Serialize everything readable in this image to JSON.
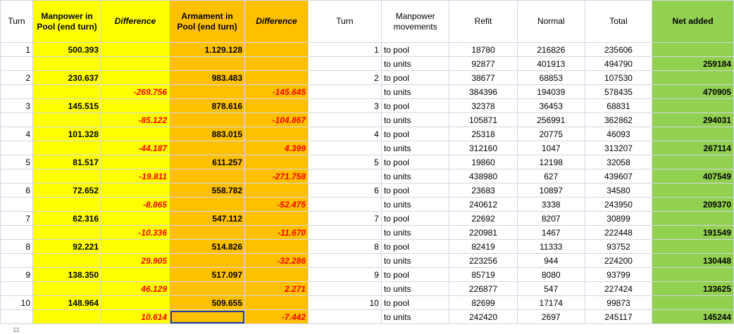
{
  "left_headers": {
    "turn": "Turn",
    "manpower": "Manpower in Pool (end turn)",
    "difference1": "Difference",
    "armament": "Armament in Pool (end turn)",
    "difference2": "Difference"
  },
  "right_headers": {
    "turn": "Turn",
    "movements": "Manpower movements",
    "refit": "Refit",
    "normal": "Normal",
    "total": "Total",
    "net": "Net added"
  },
  "left_rows": [
    {
      "turn": "1",
      "manpower": "500.393",
      "diff1": "",
      "armament": "1.129.128",
      "diff2": ""
    },
    {
      "turn": "",
      "manpower": "",
      "diff1": "",
      "armament": "",
      "diff2": ""
    },
    {
      "turn": "2",
      "manpower": "230.637",
      "diff1": "",
      "armament": "983.483",
      "diff2": ""
    },
    {
      "turn": "",
      "manpower": "",
      "diff1": "-269.756",
      "armament": "",
      "diff2": "-145.645"
    },
    {
      "turn": "3",
      "manpower": "145.515",
      "diff1": "",
      "armament": "878.616",
      "diff2": ""
    },
    {
      "turn": "",
      "manpower": "",
      "diff1": "-85.122",
      "armament": "",
      "diff2": "-104.867"
    },
    {
      "turn": "4",
      "manpower": "101.328",
      "diff1": "",
      "armament": "883.015",
      "diff2": ""
    },
    {
      "turn": "",
      "manpower": "",
      "diff1": "-44.187",
      "armament": "",
      "diff2": "4.399"
    },
    {
      "turn": "5",
      "manpower": "81.517",
      "diff1": "",
      "armament": "611.257",
      "diff2": ""
    },
    {
      "turn": "",
      "manpower": "",
      "diff1": "-19.811",
      "armament": "",
      "diff2": "-271.758"
    },
    {
      "turn": "6",
      "manpower": "72.652",
      "diff1": "",
      "armament": "558.782",
      "diff2": ""
    },
    {
      "turn": "",
      "manpower": "",
      "diff1": "-8.865",
      "armament": "",
      "diff2": "-52.475"
    },
    {
      "turn": "7",
      "manpower": "62.316",
      "diff1": "",
      "armament": "547.112",
      "diff2": ""
    },
    {
      "turn": "",
      "manpower": "",
      "diff1": "-10.336",
      "armament": "",
      "diff2": "-11.670"
    },
    {
      "turn": "8",
      "manpower": "92.221",
      "diff1": "",
      "armament": "514.826",
      "diff2": ""
    },
    {
      "turn": "",
      "manpower": "",
      "diff1": "29.905",
      "armament": "",
      "diff2": "-32.286"
    },
    {
      "turn": "9",
      "manpower": "138.350",
      "diff1": "",
      "armament": "517.097",
      "diff2": ""
    },
    {
      "turn": "",
      "manpower": "",
      "diff1": "46.129",
      "armament": "",
      "diff2": "2.271"
    },
    {
      "turn": "10",
      "manpower": "148.964",
      "diff1": "",
      "armament": "509.655",
      "diff2": ""
    },
    {
      "turn": "",
      "manpower": "",
      "diff1": "10.614",
      "armament": "",
      "diff2": "-7.442"
    }
  ],
  "right_rows": [
    {
      "turn": "1",
      "move": "to pool",
      "refit": "18780",
      "normal": "216826",
      "total": "235606",
      "net": ""
    },
    {
      "turn": "",
      "move": "to units",
      "refit": "92877",
      "normal": "401913",
      "total": "494790",
      "net": "259184"
    },
    {
      "turn": "2",
      "move": "to pool",
      "refit": "38677",
      "normal": "68853",
      "total": "107530",
      "net": ""
    },
    {
      "turn": "",
      "move": "to units",
      "refit": "384396",
      "normal": "194039",
      "total": "578435",
      "net": "470905"
    },
    {
      "turn": "3",
      "move": "to pool",
      "refit": "32378",
      "normal": "36453",
      "total": "68831",
      "net": ""
    },
    {
      "turn": "",
      "move": "to units",
      "refit": "105871",
      "normal": "256991",
      "total": "362862",
      "net": "294031"
    },
    {
      "turn": "4",
      "move": "to pool",
      "refit": "25318",
      "normal": "20775",
      "total": "46093",
      "net": ""
    },
    {
      "turn": "",
      "move": "to units",
      "refit": "312160",
      "normal": "1047",
      "total": "313207",
      "net": "267114"
    },
    {
      "turn": "5",
      "move": "to pool",
      "refit": "19860",
      "normal": "12198",
      "total": "32058",
      "net": ""
    },
    {
      "turn": "",
      "move": "to units",
      "refit": "438980",
      "normal": "627",
      "total": "439607",
      "net": "407549"
    },
    {
      "turn": "6",
      "move": "to pool",
      "refit": "23683",
      "normal": "10897",
      "total": "34580",
      "net": ""
    },
    {
      "turn": "",
      "move": "to units",
      "refit": "240612",
      "normal": "3338",
      "total": "243950",
      "net": "209370"
    },
    {
      "turn": "7",
      "move": "to pool",
      "refit": "22692",
      "normal": "8207",
      "total": "30899",
      "net": ""
    },
    {
      "turn": "",
      "move": "to units",
      "refit": "220981",
      "normal": "1467",
      "total": "222448",
      "net": "191549"
    },
    {
      "turn": "8",
      "move": "to pool",
      "refit": "82419",
      "normal": "11333",
      "total": "93752",
      "net": ""
    },
    {
      "turn": "",
      "move": "to units",
      "refit": "223256",
      "normal": "944",
      "total": "224200",
      "net": "130448"
    },
    {
      "turn": "9",
      "move": "to pool",
      "refit": "85719",
      "normal": "8080",
      "total": "93799",
      "net": ""
    },
    {
      "turn": "",
      "move": "to units",
      "refit": "226877",
      "normal": "547",
      "total": "227424",
      "net": "133625"
    },
    {
      "turn": "10",
      "move": "to pool",
      "refit": "82699",
      "normal": "17174",
      "total": "99873",
      "net": ""
    },
    {
      "turn": "",
      "move": "to units",
      "refit": "242420",
      "normal": "2697",
      "total": "245117",
      "net": "145244"
    }
  ],
  "next_row_number": "11",
  "colors": {
    "manpower": "#ffff00",
    "armament": "#ffc000",
    "net": "#92d050",
    "negative": "#ff0000",
    "selection": "#1f3ea0",
    "gridline": "#d0d7e5"
  }
}
